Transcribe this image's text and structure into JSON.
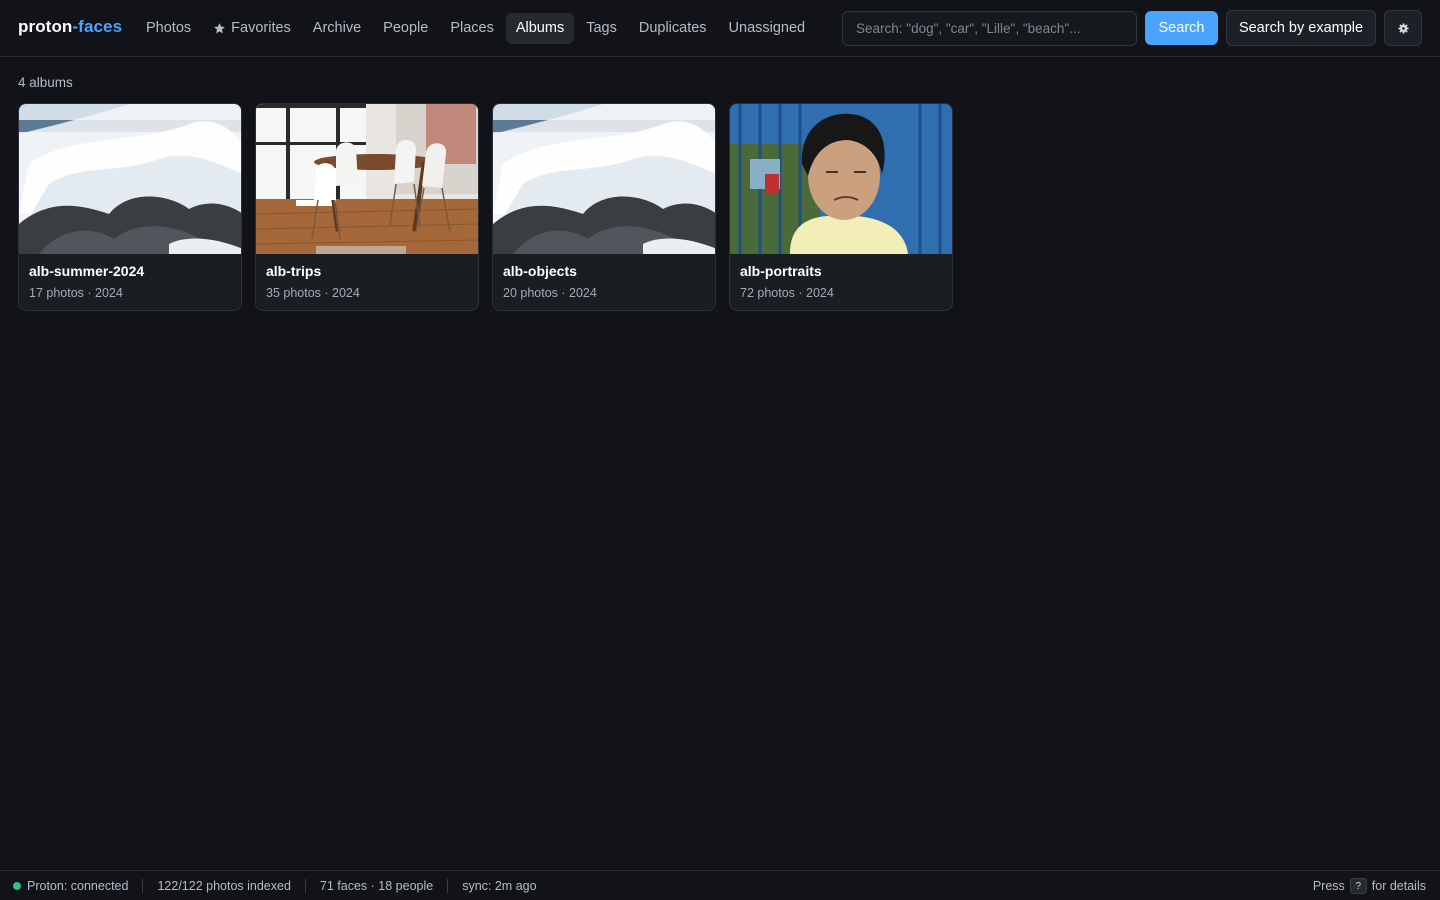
{
  "app": {
    "brand_main": "proton",
    "brand_accent": "-faces",
    "accent_color": "#4aa3ff"
  },
  "nav": {
    "items": [
      {
        "label": "Photos",
        "active": false
      },
      {
        "label": "Favorites",
        "active": false,
        "icon": "star-icon"
      },
      {
        "label": "Archive",
        "active": false
      },
      {
        "label": "People",
        "active": false
      },
      {
        "label": "Places",
        "active": false
      },
      {
        "label": "Albums",
        "active": true
      },
      {
        "label": "Tags",
        "active": false
      },
      {
        "label": "Duplicates",
        "active": false
      },
      {
        "label": "Unassigned",
        "active": false
      }
    ]
  },
  "search": {
    "placeholder": "Search: \"dog\", \"car\", \"Lille\", \"beach\"...",
    "value": "",
    "search_label": "Search",
    "example_label": "Search by example",
    "settings_icon": "gear-icon"
  },
  "albums": {
    "count_label": "4 albums",
    "items": [
      {
        "title": "alb-summer-2024",
        "meta": "17 photos · 2024",
        "thumb": "ocean-wave"
      },
      {
        "title": "alb-trips",
        "meta": "35 photos · 2024",
        "thumb": "dining-room"
      },
      {
        "title": "alb-objects",
        "meta": "20 photos · 2024",
        "thumb": "ocean-wave"
      },
      {
        "title": "alb-portraits",
        "meta": "72 photos · 2024",
        "thumb": "portrait"
      }
    ]
  },
  "status": {
    "connection": "Proton: connected",
    "indexed": "122/122 photos indexed",
    "faces": "71 faces · 18 people",
    "sync": "sync: 2m ago",
    "help_prefix": "Press",
    "help_key": "?",
    "help_suffix": "for details",
    "connected_color": "#2ec27e"
  }
}
